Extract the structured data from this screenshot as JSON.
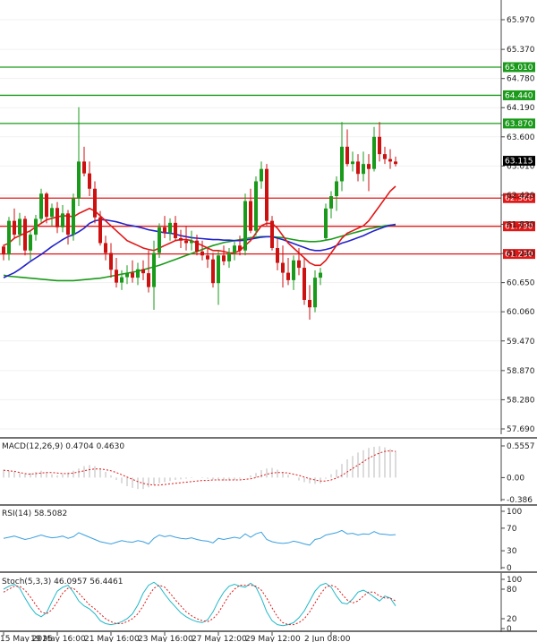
{
  "chart_data": {
    "type": "candlestick",
    "main": {
      "y_ticks": [
        "65.970",
        "65.370",
        "64.780",
        "64.190",
        "63.600",
        "63.010",
        "62.420",
        "61.830",
        "61.240",
        "60.650",
        "60.060",
        "59.470",
        "58.870",
        "58.280",
        "57.690"
      ],
      "current_price": "63.115",
      "levels": [
        {
          "value": "65.010",
          "kind": "resistance",
          "color": "#1a9a1a"
        },
        {
          "value": "64.440",
          "kind": "resistance",
          "color": "#1a9a1a"
        },
        {
          "value": "63.870",
          "kind": "resistance",
          "color": "#1a9a1a"
        },
        {
          "value": "62.360",
          "kind": "support",
          "color": "#e01818"
        },
        {
          "value": "61.790",
          "kind": "support",
          "color": "#e01818"
        },
        {
          "value": "61.230",
          "kind": "support",
          "color": "#e01818"
        }
      ],
      "colors": {
        "up": "#1a9a1a",
        "down": "#cc1111",
        "ma_fast": "#e01818",
        "ma_mid": "#2222cc",
        "ma_slow": "#1a9a1a"
      },
      "candles": [
        [
          61.38,
          61.42,
          61.1,
          61.22
        ],
        [
          61.22,
          61.98,
          61.1,
          61.9
        ],
        [
          61.9,
          62.15,
          61.55,
          61.62
        ],
        [
          61.62,
          62.06,
          61.4,
          61.94
        ],
        [
          61.94,
          62.0,
          61.2,
          61.3
        ],
        [
          61.3,
          61.7,
          61.1,
          61.62
        ],
        [
          61.62,
          62.02,
          61.5,
          61.94
        ],
        [
          61.94,
          62.55,
          61.86,
          62.45
        ],
        [
          62.45,
          62.48,
          61.85,
          61.98
        ],
        [
          61.98,
          62.25,
          61.8,
          62.16
        ],
        [
          62.16,
          62.28,
          61.65,
          61.77
        ],
        [
          61.77,
          62.22,
          61.67,
          62.05
        ],
        [
          62.05,
          62.12,
          61.42,
          61.62
        ],
        [
          61.62,
          62.45,
          61.5,
          62.35
        ],
        [
          62.35,
          64.2,
          62.2,
          63.1
        ],
        [
          63.1,
          63.4,
          62.8,
          62.86
        ],
        [
          62.86,
          63.1,
          62.4,
          62.55
        ],
        [
          62.55,
          62.7,
          61.85,
          61.97
        ],
        [
          61.97,
          62.1,
          61.4,
          61.45
        ],
        [
          61.45,
          61.6,
          61.1,
          61.25
        ],
        [
          61.25,
          61.45,
          60.75,
          60.91
        ],
        [
          60.91,
          61.15,
          60.55,
          60.65
        ],
        [
          60.65,
          60.9,
          60.5,
          60.76
        ],
        [
          60.76,
          61.0,
          60.62,
          60.85
        ],
        [
          60.85,
          61.1,
          60.65,
          60.75
        ],
        [
          60.75,
          61.05,
          60.6,
          60.92
        ],
        [
          60.92,
          61.1,
          60.7,
          60.84
        ],
        [
          60.84,
          61.3,
          60.45,
          60.56
        ],
        [
          60.56,
          61.5,
          60.1,
          61.25
        ],
        [
          61.25,
          61.85,
          61.15,
          61.77
        ],
        [
          61.77,
          62.0,
          61.55,
          61.66
        ],
        [
          61.66,
          61.95,
          61.5,
          61.86
        ],
        [
          61.86,
          62.0,
          61.5,
          61.55
        ],
        [
          61.55,
          61.72,
          61.35,
          61.5
        ],
        [
          61.5,
          61.8,
          61.3,
          61.45
        ],
        [
          61.45,
          61.7,
          61.3,
          61.5
        ],
        [
          61.5,
          61.62,
          61.2,
          61.28
        ],
        [
          61.28,
          61.5,
          61.1,
          61.2
        ],
        [
          61.2,
          61.35,
          60.95,
          61.12
        ],
        [
          61.12,
          61.25,
          60.55,
          60.64
        ],
        [
          60.64,
          61.3,
          60.2,
          61.2
        ],
        [
          61.2,
          61.4,
          61.0,
          61.08
        ],
        [
          61.08,
          61.35,
          60.95,
          61.25
        ],
        [
          61.25,
          61.5,
          61.1,
          61.4
        ],
        [
          61.4,
          61.6,
          61.2,
          61.3
        ],
        [
          61.3,
          62.45,
          61.2,
          62.3
        ],
        [
          62.3,
          62.55,
          61.65,
          61.7
        ],
        [
          61.7,
          62.8,
          61.6,
          62.7
        ],
        [
          62.7,
          63.1,
          62.55,
          62.95
        ],
        [
          62.95,
          63.05,
          61.8,
          61.9
        ],
        [
          61.9,
          62.0,
          61.3,
          61.35
        ],
        [
          61.35,
          61.55,
          60.9,
          61.05
        ],
        [
          61.05,
          61.4,
          60.55,
          60.85
        ],
        [
          60.85,
          61.15,
          60.6,
          60.7
        ],
        [
          60.7,
          61.2,
          60.5,
          61.1
        ],
        [
          61.1,
          61.35,
          60.8,
          60.95
        ],
        [
          60.95,
          61.15,
          60.2,
          60.3
        ],
        [
          60.3,
          60.6,
          59.9,
          60.15
        ],
        [
          60.15,
          60.9,
          60.05,
          60.75
        ],
        [
          60.75,
          60.95,
          60.6,
          60.85
        ],
        [
          61.55,
          62.25,
          61.5,
          62.15
        ],
        [
          62.15,
          62.5,
          61.95,
          62.4
        ],
        [
          62.4,
          62.8,
          62.1,
          62.7
        ],
        [
          62.7,
          63.9,
          62.5,
          63.4
        ],
        [
          63.4,
          63.75,
          63.0,
          63.05
        ],
        [
          63.05,
          63.3,
          62.9,
          63.1
        ],
        [
          63.1,
          63.25,
          62.7,
          62.85
        ],
        [
          62.85,
          63.3,
          62.7,
          63.05
        ],
        [
          63.05,
          63.25,
          62.5,
          62.95
        ],
        [
          62.95,
          63.8,
          62.9,
          63.6
        ],
        [
          63.6,
          63.9,
          63.1,
          63.25
        ],
        [
          63.25,
          63.4,
          63.05,
          63.15
        ],
        [
          63.15,
          63.35,
          62.95,
          63.1
        ],
        [
          63.1,
          63.2,
          63.0,
          63.05
        ]
      ],
      "ma_fast": [
        61.4,
        61.45,
        61.55,
        61.6,
        61.65,
        61.7,
        61.78,
        61.85,
        61.92,
        61.95,
        61.98,
        62.0,
        62.0,
        61.98,
        62.05,
        62.1,
        62.15,
        62.1,
        62.0,
        61.9,
        61.8,
        61.7,
        61.6,
        61.5,
        61.45,
        61.4,
        61.35,
        61.32,
        61.3,
        61.35,
        61.4,
        61.45,
        61.5,
        61.52,
        61.52,
        61.5,
        61.45,
        61.4,
        61.35,
        61.3,
        61.3,
        61.28,
        61.25,
        61.25,
        61.3,
        61.4,
        61.5,
        61.65,
        61.8,
        61.85,
        61.85,
        61.75,
        61.6,
        61.45,
        61.35,
        61.25,
        61.15,
        61.05,
        61.0,
        61.0,
        61.1,
        61.25,
        61.4,
        61.55,
        61.65,
        61.7,
        61.75,
        61.8,
        61.9,
        62.05,
        62.2,
        62.35,
        62.5,
        62.6
      ],
      "ma_mid": [
        60.75,
        60.8,
        60.85,
        60.92,
        61.0,
        61.08,
        61.15,
        61.22,
        61.3,
        61.38,
        61.45,
        61.52,
        61.58,
        61.62,
        61.68,
        61.75,
        61.85,
        61.9,
        61.92,
        61.92,
        61.9,
        61.88,
        61.85,
        61.82,
        61.8,
        61.78,
        61.75,
        61.72,
        61.7,
        61.68,
        61.66,
        61.65,
        61.63,
        61.6,
        61.58,
        61.56,
        61.55,
        61.54,
        61.53,
        61.52,
        61.52,
        61.51,
        61.51,
        61.5,
        61.5,
        61.51,
        61.53,
        61.55,
        61.57,
        61.58,
        61.58,
        61.55,
        61.52,
        61.48,
        61.44,
        61.4,
        61.36,
        61.32,
        61.3,
        61.3,
        61.32,
        61.35,
        61.4,
        61.45,
        61.48,
        61.52,
        61.56,
        61.6,
        61.65,
        61.7,
        61.74,
        61.78,
        61.81,
        61.83
      ],
      "ma_slow": [
        60.8,
        60.78,
        60.77,
        60.76,
        60.75,
        60.74,
        60.73,
        60.72,
        60.71,
        60.7,
        60.69,
        60.69,
        60.69,
        60.69,
        60.7,
        60.71,
        60.72,
        60.73,
        60.74,
        60.76,
        60.78,
        60.8,
        60.82,
        60.84,
        60.86,
        60.88,
        60.91,
        60.94,
        60.97,
        61.0,
        61.04,
        61.08,
        61.12,
        61.16,
        61.2,
        61.24,
        61.28,
        61.32,
        61.36,
        61.4,
        61.43,
        61.46,
        61.48,
        61.5,
        61.52,
        61.54,
        61.56,
        61.57,
        61.58,
        61.58,
        61.58,
        61.57,
        61.56,
        61.54,
        61.52,
        61.5,
        61.49,
        61.48,
        61.48,
        61.49,
        61.51,
        61.53,
        61.56,
        61.59,
        61.62,
        61.65,
        61.68,
        61.71,
        61.74,
        61.76,
        61.78,
        61.8,
        61.81,
        61.82
      ]
    },
    "macd": {
      "label": "MACD(12,26,9) 0.4704 0.4630",
      "y_ticks": [
        "0.5557",
        "0.00",
        "-0.386"
      ],
      "hist": [
        0.14,
        0.12,
        0.1,
        0.08,
        0.06,
        0.08,
        0.1,
        0.12,
        0.1,
        0.06,
        0.04,
        0.06,
        0.09,
        0.12,
        0.16,
        0.2,
        0.22,
        0.2,
        0.16,
        0.1,
        0.04,
        -0.04,
        -0.1,
        -0.15,
        -0.18,
        -0.2,
        -0.2,
        -0.17,
        -0.13,
        -0.1,
        -0.08,
        -0.06,
        -0.04,
        -0.03,
        -0.02,
        -0.01,
        0.0,
        -0.01,
        -0.02,
        -0.03,
        -0.04,
        -0.05,
        -0.05,
        -0.04,
        -0.02,
        0.0,
        0.04,
        0.08,
        0.13,
        0.16,
        0.17,
        0.14,
        0.1,
        0.05,
        0.0,
        -0.05,
        -0.08,
        -0.1,
        -0.11,
        -0.1,
        -0.02,
        0.06,
        0.14,
        0.24,
        0.32,
        0.38,
        0.44,
        0.48,
        0.52,
        0.54,
        0.55,
        0.53,
        0.5,
        0.47
      ],
      "signal": [
        0.13,
        0.12,
        0.11,
        0.09,
        0.07,
        0.06,
        0.07,
        0.08,
        0.09,
        0.09,
        0.08,
        0.07,
        0.07,
        0.08,
        0.1,
        0.12,
        0.14,
        0.15,
        0.15,
        0.14,
        0.12,
        0.09,
        0.05,
        0.01,
        -0.03,
        -0.07,
        -0.1,
        -0.12,
        -0.13,
        -0.13,
        -0.12,
        -0.11,
        -0.1,
        -0.09,
        -0.08,
        -0.07,
        -0.06,
        -0.05,
        -0.05,
        -0.04,
        -0.04,
        -0.04,
        -0.04,
        -0.04,
        -0.04,
        -0.03,
        -0.02,
        0.0,
        0.03,
        0.06,
        0.08,
        0.09,
        0.09,
        0.08,
        0.06,
        0.04,
        0.01,
        -0.02,
        -0.04,
        -0.06,
        -0.06,
        -0.04,
        -0.01,
        0.04,
        0.1,
        0.16,
        0.22,
        0.28,
        0.34,
        0.39,
        0.43,
        0.46,
        0.47,
        0.46
      ]
    },
    "rsi": {
      "label": "RSI(14) 58.5082",
      "y_ticks": [
        "100",
        "70",
        "30",
        "0"
      ],
      "values": [
        52,
        54,
        56,
        53,
        50,
        52,
        55,
        58,
        55,
        53,
        54,
        56,
        52,
        55,
        62,
        58,
        54,
        50,
        46,
        44,
        42,
        45,
        48,
        46,
        45,
        48,
        46,
        42,
        52,
        58,
        55,
        57,
        54,
        52,
        51,
        53,
        50,
        48,
        47,
        44,
        52,
        50,
        52,
        54,
        52,
        60,
        54,
        60,
        63,
        50,
        46,
        44,
        43,
        44,
        47,
        45,
        42,
        40,
        50,
        52,
        58,
        60,
        62,
        66,
        60,
        61,
        58,
        60,
        59,
        64,
        60,
        59,
        58,
        58.5
      ]
    },
    "stoch": {
      "label": "Stoch(5,3,3) 46.0957 56.4461",
      "y_ticks": [
        "100",
        "80",
        "20",
        "0"
      ],
      "k": [
        80,
        86,
        90,
        82,
        62,
        44,
        30,
        24,
        32,
        55,
        76,
        84,
        88,
        74,
        56,
        46,
        40,
        30,
        16,
        10,
        8,
        10,
        14,
        20,
        30,
        48,
        72,
        88,
        94,
        86,
        70,
        56,
        44,
        32,
        24,
        18,
        14,
        12,
        18,
        34,
        56,
        74,
        86,
        90,
        86,
        84,
        92,
        84,
        62,
        34,
        16,
        8,
        6,
        8,
        12,
        22,
        36,
        56,
        76,
        88,
        92,
        84,
        66,
        52,
        50,
        60,
        74,
        78,
        72,
        64,
        56,
        66,
        62,
        46
      ],
      "d": [
        74,
        80,
        86,
        86,
        78,
        64,
        48,
        34,
        30,
        38,
        54,
        72,
        82,
        82,
        72,
        60,
        48,
        40,
        30,
        20,
        14,
        10,
        10,
        14,
        20,
        30,
        46,
        66,
        82,
        88,
        84,
        72,
        58,
        46,
        34,
        26,
        20,
        16,
        14,
        20,
        32,
        50,
        68,
        80,
        88,
        88,
        88,
        86,
        78,
        62,
        42,
        24,
        12,
        8,
        8,
        12,
        20,
        34,
        52,
        70,
        84,
        88,
        84,
        70,
        58,
        52,
        56,
        66,
        74,
        74,
        66,
        62,
        62,
        56
      ]
    },
    "x_labels": [
      {
        "text": "15 May 2025",
        "i": 0
      },
      {
        "text": "19 May 16:00",
        "i": 10
      },
      {
        "text": "21 May 16:00",
        "i": 20
      },
      {
        "text": "23 May 16:00",
        "i": 30
      },
      {
        "text": "27 May 12:00",
        "i": 40
      },
      {
        "text": "29 May 12:00",
        "i": 50
      },
      {
        "text": "2 Jun 08:00",
        "i": 61
      }
    ]
  }
}
